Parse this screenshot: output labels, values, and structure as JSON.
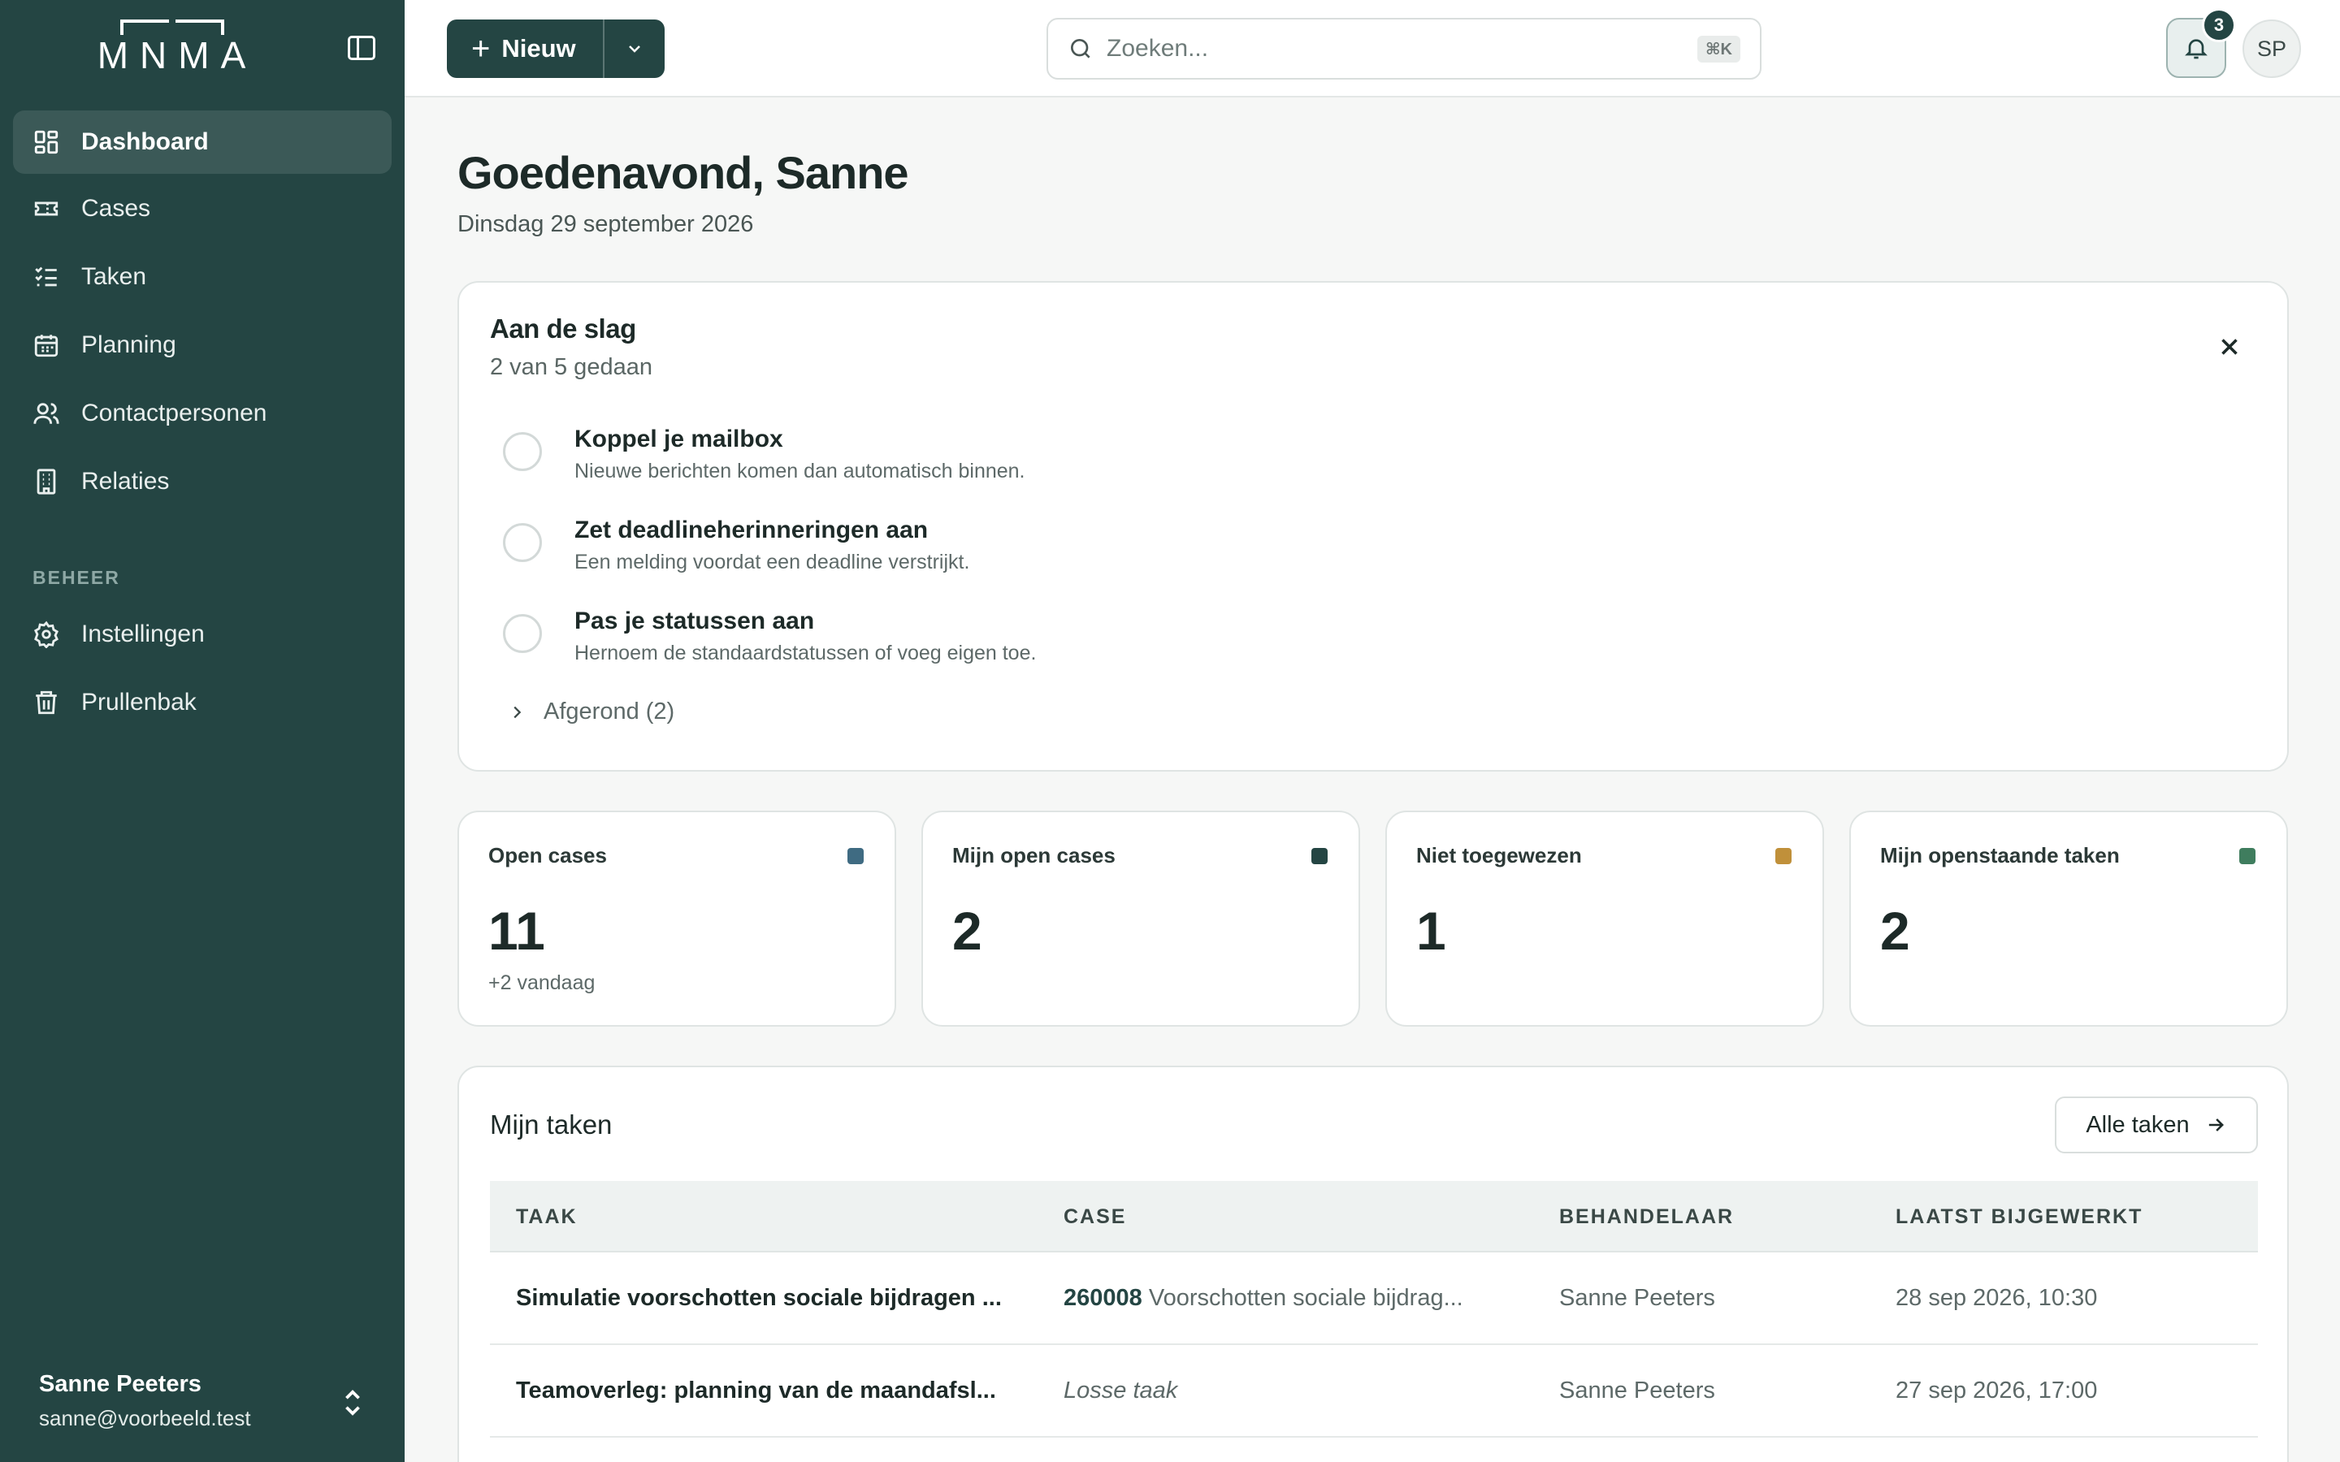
{
  "sidebar": {
    "logo": "MNMA",
    "items": [
      {
        "label": "Dashboard",
        "icon": "dashboard-icon",
        "active": true
      },
      {
        "label": "Cases",
        "icon": "ticket-icon"
      },
      {
        "label": "Taken",
        "icon": "checklist-icon"
      },
      {
        "label": "Planning",
        "icon": "calendar-icon"
      },
      {
        "label": "Contactpersonen",
        "icon": "users-icon"
      },
      {
        "label": "Relaties",
        "icon": "building-icon"
      }
    ],
    "section_label": "BEHEER",
    "admin_items": [
      {
        "label": "Instellingen",
        "icon": "gear-icon"
      },
      {
        "label": "Prullenbak",
        "icon": "trash-icon"
      }
    ],
    "user": {
      "name": "Sanne Peeters",
      "email": "sanne@voorbeeld.test"
    }
  },
  "topbar": {
    "new_label": "Nieuw",
    "search_placeholder": "Zoeken...",
    "search_shortcut": "⌘K",
    "notification_count": "3",
    "avatar_initials": "SP"
  },
  "main": {
    "greeting": "Goedenavond, Sanne",
    "date": "Dinsdag 29 september 2026",
    "onboarding": {
      "title": "Aan de slag",
      "progress": "2 van 5 gedaan",
      "steps": [
        {
          "title": "Koppel je mailbox",
          "description": "Nieuwe berichten komen dan automatisch binnen."
        },
        {
          "title": "Zet deadlineherinneringen aan",
          "description": "Een melding voordat een deadline verstrijkt."
        },
        {
          "title": "Pas je statussen aan",
          "description": "Hernoem de standaardstatussen of voeg eigen toe."
        }
      ],
      "completed_toggle": "Afgerond (2)"
    },
    "stats": [
      {
        "label": "Open cases",
        "value": "11",
        "sub": "+2 vandaag",
        "color": "#3f6b82"
      },
      {
        "label": "Mijn open cases",
        "value": "2",
        "sub": "",
        "color": "#244543"
      },
      {
        "label": "Niet toegewezen",
        "value": "1",
        "sub": "",
        "color": "#c0903a"
      },
      {
        "label": "Mijn openstaande taken",
        "value": "2",
        "sub": "",
        "color": "#3f7d5e"
      }
    ],
    "tasks": {
      "title": "Mijn taken",
      "all_button": "Alle taken",
      "columns": [
        "TAAK",
        "CASE",
        "BEHANDELAAR",
        "LAATST BIJGEWERKT"
      ],
      "rows": [
        {
          "task": "Simulatie voorschotten sociale bijdragen ...",
          "case_number": "260008",
          "case_title": "Voorschotten sociale bijdrag...",
          "assignee": "Sanne Peeters",
          "updated": "28 sep 2026, 10:30"
        },
        {
          "task": "Teamoverleg: planning van de maandafsl...",
          "case_number": "",
          "case_title": "Losse taak",
          "assignee": "Sanne Peeters",
          "updated": "27 sep 2026, 17:00"
        }
      ]
    }
  }
}
